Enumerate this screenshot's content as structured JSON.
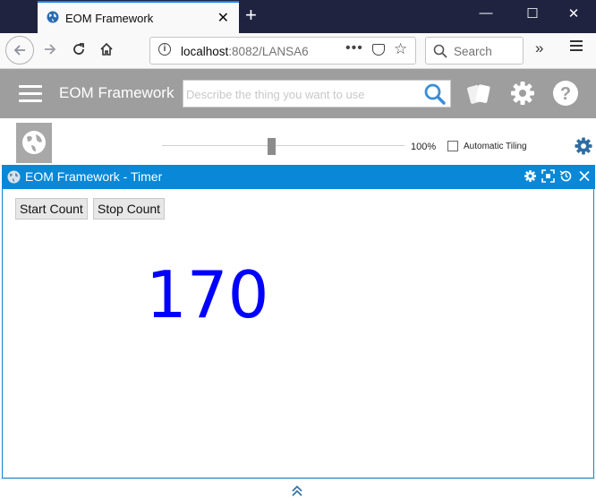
{
  "browser": {
    "tab_title": "EOM Framework",
    "tab_close": "✕",
    "new_tab": "+",
    "window_controls": {
      "minimize": "—",
      "maximize": "☐",
      "close": "✕"
    },
    "url_host": "localhost",
    "url_rest": ":8082/LANSA6",
    "search_placeholder": "Search",
    "url_more": "•••",
    "overflow": "»"
  },
  "app": {
    "title": "EOM Framework",
    "search_placeholder": "Describe the thing you want to use"
  },
  "toolbar": {
    "zoom_label": "100%",
    "zoom_value": 0.45,
    "tiling_label": "Automatic Tiling",
    "tiling_checked": false
  },
  "panel": {
    "title": "EOM Framework - Timer",
    "start_label": "Start Count",
    "stop_label": "Stop Count",
    "count": "170"
  },
  "colors": {
    "tab_bar": "#202340",
    "app_header": "#9e9e9e",
    "panel_titlebar": "#0888d6",
    "counter": "#0000ff"
  }
}
